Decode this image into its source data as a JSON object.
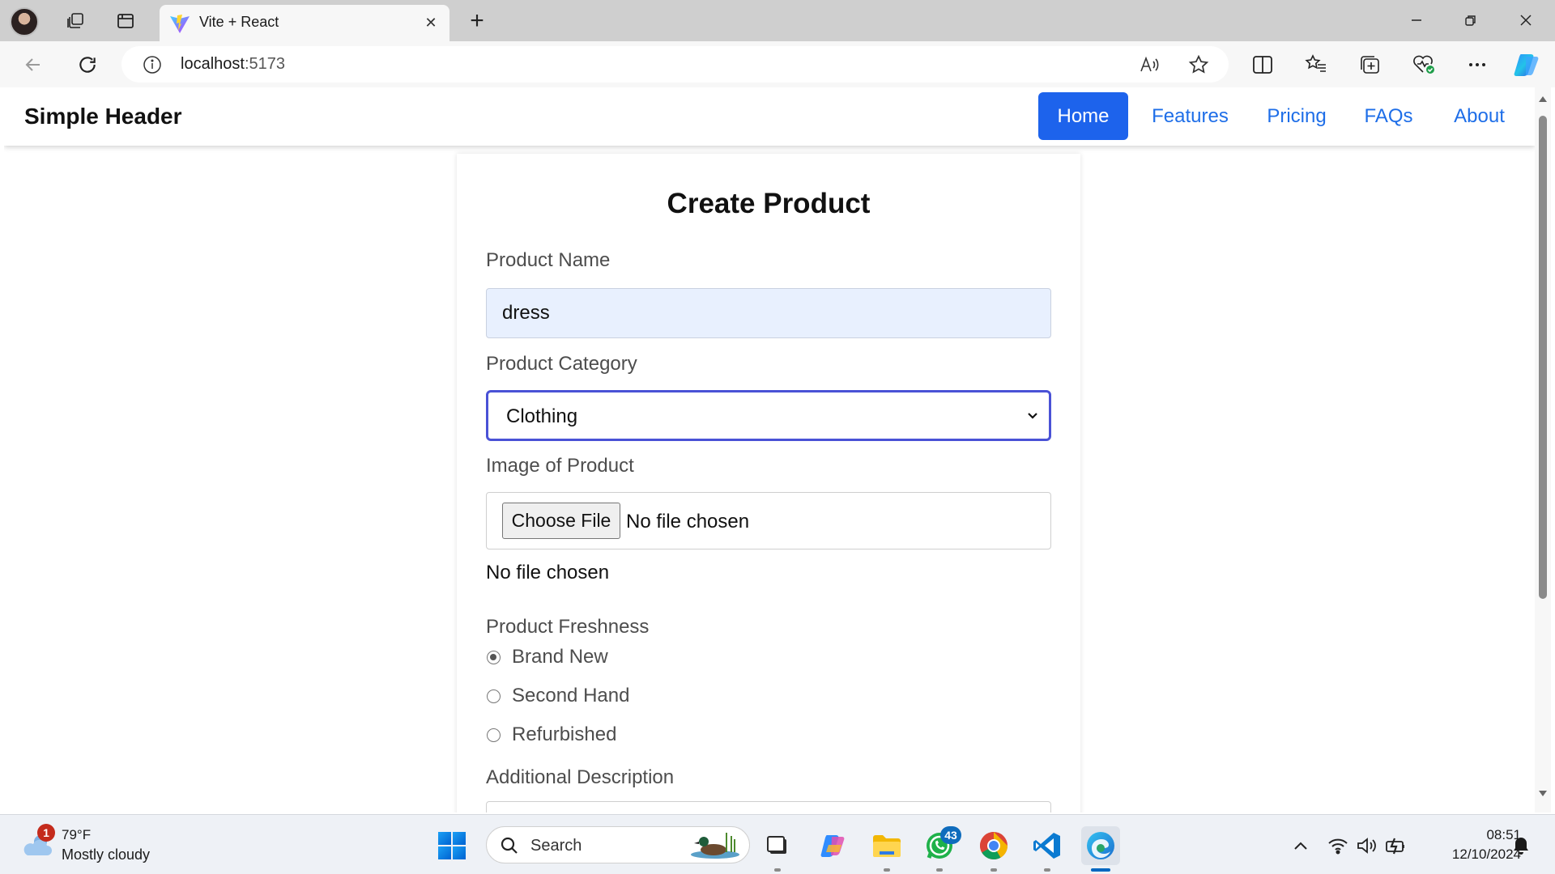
{
  "browser": {
    "tab_title": "Vite + React",
    "url_host": "localhost",
    "url_port": ":5173"
  },
  "site": {
    "brand": "Simple Header",
    "nav": [
      "Home",
      "Features",
      "Pricing",
      "FAQs",
      "About"
    ],
    "active_nav": "Home",
    "accent": "#1d63ec"
  },
  "form": {
    "title": "Create Product",
    "name_label": "Product Name",
    "name_value": "dress",
    "category_label": "Product Category",
    "category_value": "Clothing",
    "image_label": "Image of Product",
    "choose_file": "Choose File",
    "file_status": "No file chosen",
    "file_status_below": "No file chosen",
    "freshness_label": "Product Freshness",
    "freshness_options": [
      "Brand New",
      "Second Hand",
      "Refurbished"
    ],
    "freshness_selected": "Brand New",
    "description_label": "Additional Description"
  },
  "taskbar": {
    "weather_temp": "79°F",
    "weather_desc": "Mostly cloudy",
    "weather_badge": "1",
    "search_placeholder": "Search",
    "whatsapp_badge": "43",
    "time": "08:51",
    "date": "12/10/2024"
  }
}
